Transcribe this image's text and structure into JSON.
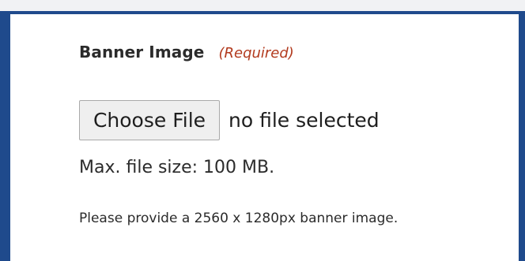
{
  "field": {
    "label": "Banner Image",
    "required_text": "(Required)"
  },
  "file_input": {
    "button_label": "Choose File",
    "status_text": "no file selected"
  },
  "max_size_text": "Max. file size: 100 MB.",
  "help_text": "Please provide a 2560 x 1280px banner image.",
  "colors": {
    "frame_border": "#1f4a8c",
    "required_text": "#b23a1e",
    "body_text": "#2b2b2b",
    "page_background": "#f1f2f4"
  }
}
